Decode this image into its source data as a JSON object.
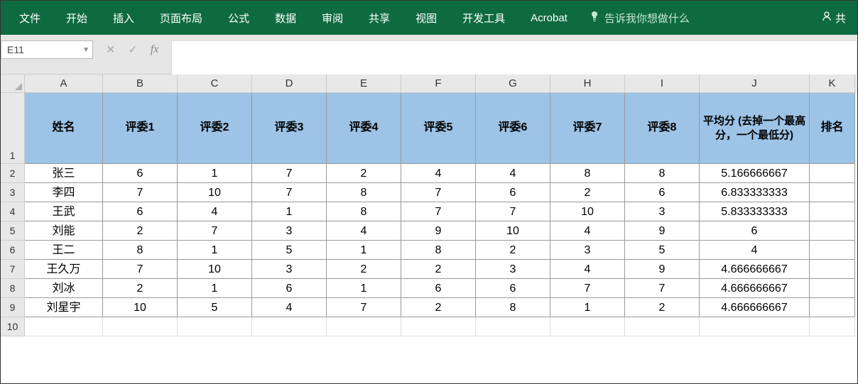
{
  "ribbon": {
    "tabs": [
      "文件",
      "开始",
      "插入",
      "页面布局",
      "公式",
      "数据",
      "审阅",
      "共享",
      "视图",
      "开发工具",
      "Acrobat"
    ],
    "tellMe": "告诉我你想做什么",
    "share": "共"
  },
  "nameBox": "E11",
  "fxCancel": "✕",
  "fxEnter": "✓",
  "fxLabel": "fx",
  "colLabels": [
    "A",
    "B",
    "C",
    "D",
    "E",
    "F",
    "G",
    "H",
    "I",
    "J",
    "K"
  ],
  "rowLabels": [
    "1",
    "2",
    "3",
    "4",
    "5",
    "6",
    "7",
    "8",
    "9",
    "10"
  ],
  "colWidths": [
    "c-A",
    "c-B",
    "c-C",
    "c-D",
    "c-E",
    "c-F",
    "c-G",
    "c-H",
    "c-I",
    "c-J",
    "c-K"
  ],
  "headers": [
    "姓名",
    "评委1",
    "评委2",
    "评委3",
    "评委4",
    "评委5",
    "评委6",
    "评委7",
    "评委8",
    "平均分\n(去掉一个最高分，一个最低分)",
    "排名"
  ],
  "rows": [
    [
      "张三",
      "6",
      "1",
      "7",
      "2",
      "4",
      "4",
      "8",
      "8",
      "5.166666667",
      ""
    ],
    [
      "李四",
      "7",
      "10",
      "7",
      "8",
      "7",
      "6",
      "2",
      "6",
      "6.833333333",
      ""
    ],
    [
      "王武",
      "6",
      "4",
      "1",
      "8",
      "7",
      "7",
      "10",
      "3",
      "5.833333333",
      ""
    ],
    [
      "刘能",
      "2",
      "7",
      "3",
      "4",
      "9",
      "10",
      "4",
      "9",
      "6",
      ""
    ],
    [
      "王二",
      "8",
      "1",
      "5",
      "1",
      "8",
      "2",
      "3",
      "5",
      "4",
      ""
    ],
    [
      "王久万",
      "7",
      "10",
      "3",
      "2",
      "2",
      "3",
      "4",
      "9",
      "4.666666667",
      ""
    ],
    [
      "刘冰",
      "2",
      "1",
      "6",
      "1",
      "6",
      "6",
      "7",
      "7",
      "4.666666667",
      ""
    ],
    [
      "刘星宇",
      "10",
      "5",
      "4",
      "7",
      "2",
      "8",
      "1",
      "2",
      "4.666666667",
      ""
    ]
  ]
}
